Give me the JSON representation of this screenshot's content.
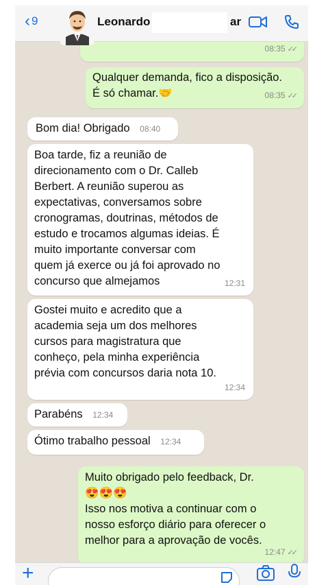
{
  "header": {
    "back_count": "9",
    "contact_name": "Leonardo",
    "contact_suffix": "ar"
  },
  "messages": [
    {
      "dir": "out",
      "lines": [],
      "time": "08:35",
      "ticks": true
    },
    {
      "dir": "out",
      "lines": [
        "Qualquer demanda, fico a disposição.",
        "É só chamar."
      ],
      "emoji": "🤝",
      "time": "08:35",
      "ticks": true
    },
    {
      "dir": "in",
      "lines": [
        "Bom dia! Obrigado"
      ],
      "time": "08:40"
    },
    {
      "dir": "in",
      "lines": [
        "Boa tarde, fiz a reunião de",
        "direcionamento com o Dr. Calleb",
        "Berbert. A reunião superou as",
        "expectativas, conversamos sobre",
        "cronogramas, doutrinas, métodos de",
        "estudo e trocamos algumas ideias. É",
        "muito importante conversar com",
        "quem já exerce ou já foi aprovado no",
        "concurso que almejamos"
      ],
      "time": "12:31"
    },
    {
      "dir": "in",
      "lines": [
        "Gostei muito e acredito que a",
        "academia seja um dos melhores",
        "cursos para magistratura que",
        "conheço, pela minha experiência",
        "prévia com concursos daria nota 10."
      ],
      "time": "12:34"
    },
    {
      "dir": "in",
      "lines": [
        "Parabéns"
      ],
      "time": "12:34"
    },
    {
      "dir": "in",
      "lines": [
        "Ótimo trabalho pessoal"
      ],
      "time": "12:34"
    },
    {
      "dir": "out",
      "lines": [
        "Muito obrigado pelo feedback, Dr.",
        "😍😍😍",
        "Isso nos motiva a continuar com o",
        "nosso esforço diário para oferecer o",
        "melhor para a aprovação de vocês."
      ],
      "time": "12:47",
      "ticks": true
    }
  ],
  "icons": [
    "chevron-left-icon",
    "video-call-icon",
    "phone-icon",
    "plus-icon",
    "sticker-icon",
    "camera-icon",
    "microphone-icon"
  ],
  "colors": {
    "accent": "#1f6fd6",
    "outgoing": "#dcf8c6",
    "incoming": "#ffffff",
    "chat_bg": "#e6dfd6"
  }
}
